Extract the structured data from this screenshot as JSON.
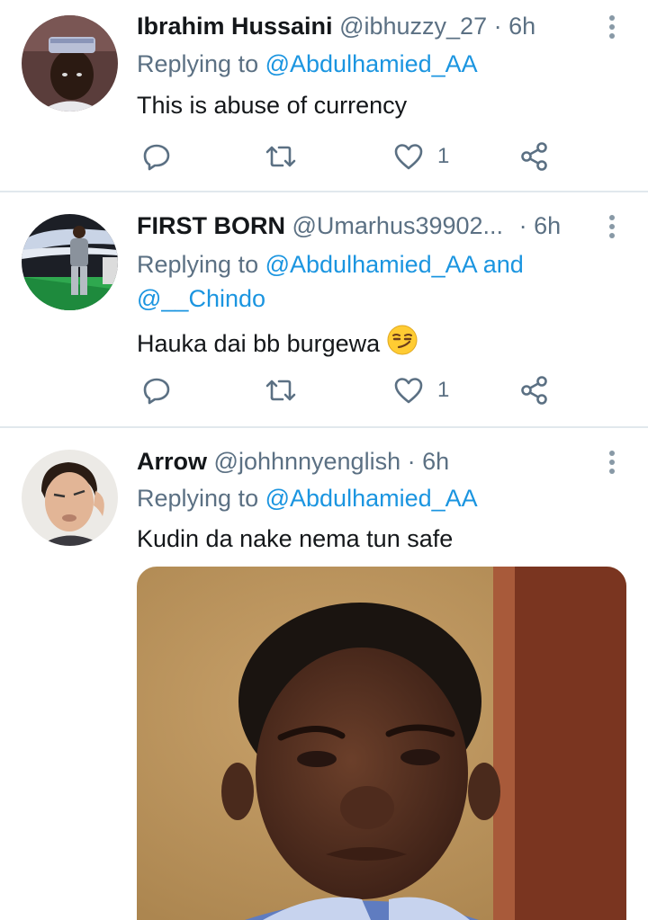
{
  "tweets": [
    {
      "name": "Ibrahim Hussaini",
      "handle": "@ibhuzzy_27",
      "dot": "·",
      "time": "6h",
      "replying_prefix": "Replying to",
      "replying_mentions": "@Abdulhamied_AA",
      "replying_mentions_2": "",
      "text": "This is abuse of currency",
      "like_count": "1"
    },
    {
      "name": "FIRST BORN",
      "handle": "@Umarhus39902...",
      "dot": "·",
      "time": "6h",
      "replying_prefix": "Replying to",
      "replying_mentions": "@Abdulhamied_AA",
      "replying_and": "and",
      "replying_mentions_2": "@__Chindo",
      "text": "Hauka dai bb burgewa",
      "emoji": "smirking-face-emoji",
      "like_count": "1"
    },
    {
      "name": "Arrow",
      "handle": "@johhnnyenglish",
      "dot": "·",
      "time": "6h",
      "replying_prefix": "Replying to",
      "replying_mentions": "@Abdulhamied_AA",
      "text": "Kudin da nake nema tun safe",
      "media": "crying-child-photo"
    }
  ],
  "icons": {
    "reply": "reply-icon",
    "retweet": "retweet-icon",
    "like": "heart-icon",
    "share": "share-icon",
    "more": "more-vertical-icon"
  },
  "colors": {
    "mention": "#1b95e0",
    "secondary_text": "#5b7083",
    "divider": "#e1e8ed",
    "icon": "#5b7083"
  }
}
